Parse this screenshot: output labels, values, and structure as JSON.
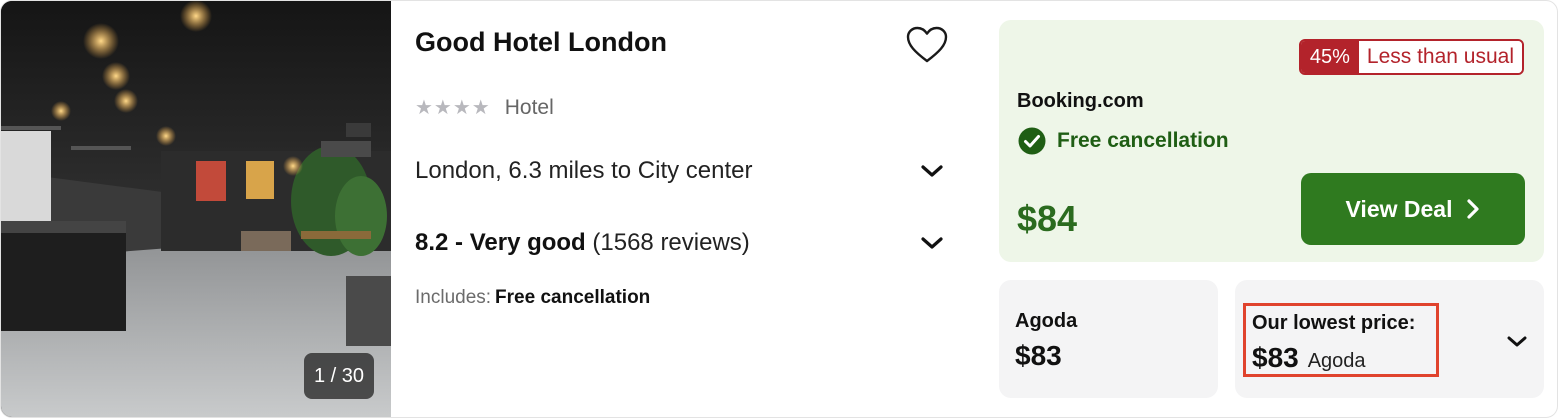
{
  "hotel": {
    "name": "Good Hotel London",
    "stars_display": "★★★★",
    "type": "Hotel",
    "location": "London, 6.3 miles to City center",
    "rating_score_label": "8.2 - Very good",
    "rating_reviews": "(1568 reviews)",
    "includes_label": "Includes:",
    "includes_value": "Free cancellation"
  },
  "photo": {
    "counter": "1 / 30"
  },
  "deal": {
    "badge_percent": "45%",
    "badge_text": "Less than usual",
    "provider": "Booking.com",
    "cancellation": "Free cancellation",
    "price": "$84",
    "button_label": "View Deal"
  },
  "alternative": {
    "provider": "Agoda",
    "price": "$83"
  },
  "lowest": {
    "label": "Our lowest price:",
    "price": "$83",
    "provider": "Agoda"
  },
  "colors": {
    "deal_bg": "#eef6e8",
    "button_green": "#2f7a1f",
    "price_green": "#2b6b1f",
    "badge_red": "#b3232b",
    "highlight_orange": "#e0432d"
  },
  "icons": [
    "heart-icon",
    "chevron-down-icon",
    "check-circle-icon",
    "chevron-right-icon",
    "star-icon"
  ]
}
